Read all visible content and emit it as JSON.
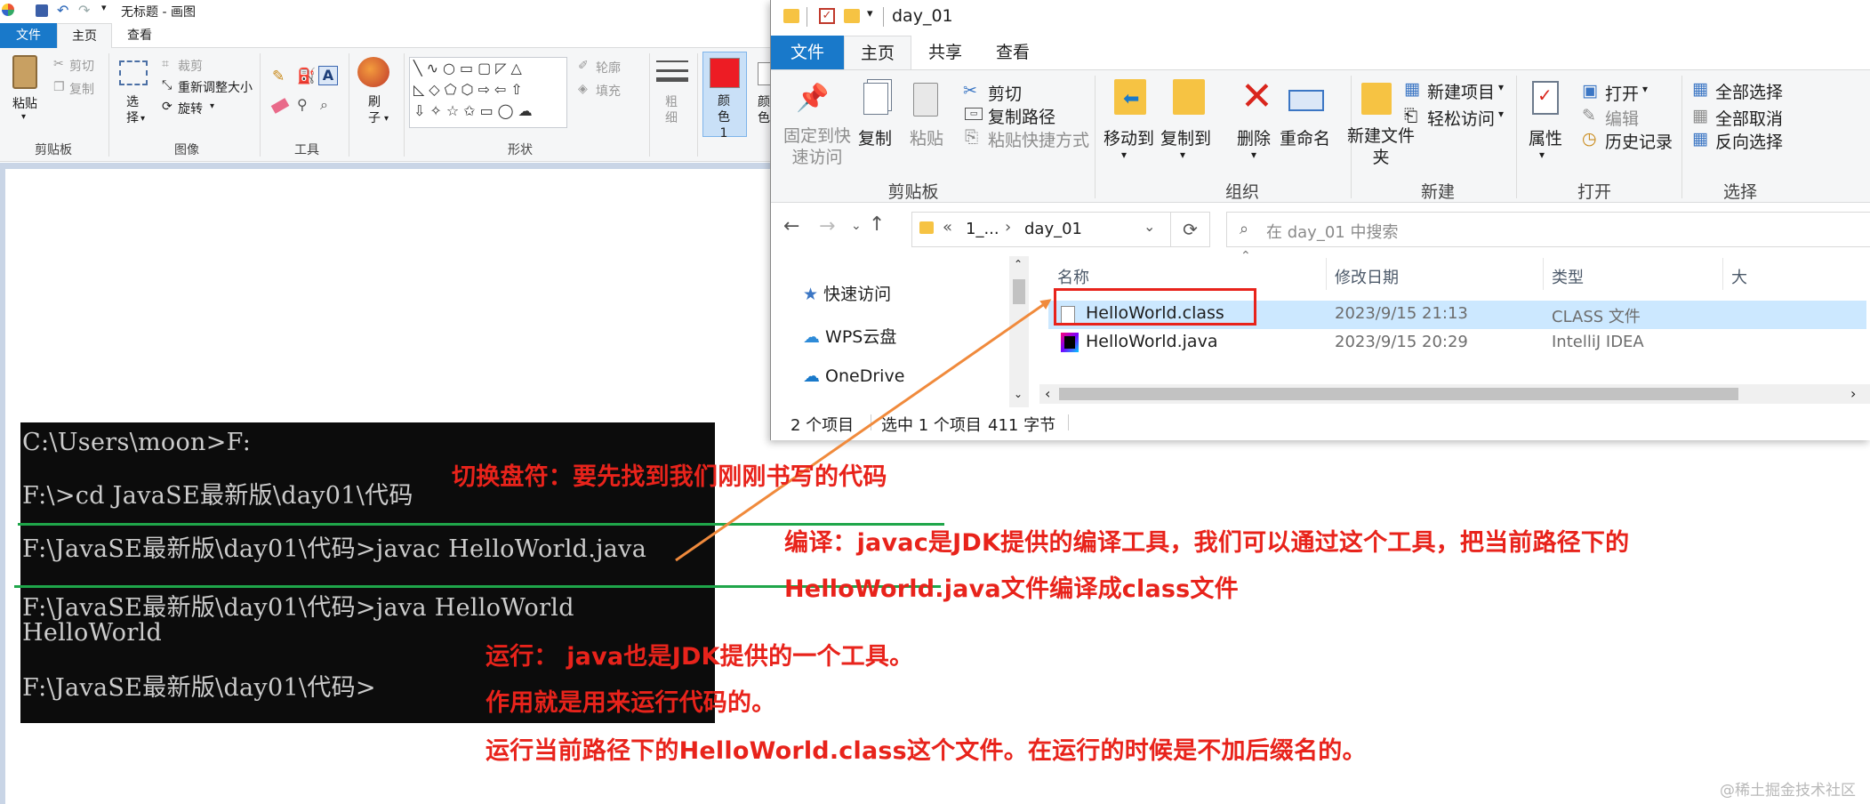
{
  "paint": {
    "title": "无标题 - 画图",
    "tabs": [
      {
        "label": "文件",
        "active": false,
        "accent": "#1979ca"
      },
      {
        "label": "主页",
        "active": true
      },
      {
        "label": "查看",
        "active": false
      }
    ],
    "clipboard": {
      "paste": "粘贴",
      "cut": "剪切",
      "copy": "复制",
      "label": "剪贴板"
    },
    "image": {
      "select": "选择",
      "crop": "裁剪",
      "resize": "重新调整大小",
      "rotate": "旋转",
      "label": "图像"
    },
    "tools": {
      "label": "工具"
    },
    "brush": {
      "label": "刷子"
    },
    "shapes": {
      "outline": "轮廓",
      "fill": "填充",
      "label": "形状"
    },
    "size": {
      "label": "粗细"
    },
    "color1": {
      "label": "颜色 1",
      "color": "#ed1c24"
    },
    "color2": {
      "label": "颜色"
    }
  },
  "cmd": {
    "lines": [
      "C:\\Users\\moon>F:",
      "F:\\>cd JavaSE最新版\\day01\\代码",
      "F:\\JavaSE最新版\\day01\\代码>javac HelloWorld.java",
      "F:\\JavaSE最新版\\day01\\代码>java HelloWorld",
      "HelloWorld",
      "F:\\JavaSE最新版\\day01\\代码>"
    ]
  },
  "explorer": {
    "title": "day_01",
    "tabs": [
      {
        "label": "文件",
        "accent": "#1979ca"
      },
      {
        "label": "主页"
      },
      {
        "label": "共享"
      },
      {
        "label": "查看"
      }
    ],
    "clipboard": {
      "pin": "固定到快速访问",
      "copy": "复制",
      "paste": "粘贴",
      "cut": "剪切",
      "copy_path": "复制路径",
      "paste_shortcut": "粘贴快捷方式",
      "label": "剪贴板"
    },
    "organize": {
      "move_to": "移动到",
      "copy_to": "复制到",
      "delete": "删除",
      "rename": "重命名",
      "label": "组织"
    },
    "new": {
      "new_folder": "新建文件夹",
      "new_item": "新建项目",
      "easy_access": "轻松访问",
      "label": "新建"
    },
    "open": {
      "properties": "属性",
      "open": "打开",
      "edit": "编辑",
      "history": "历史记录",
      "label": "打开"
    },
    "select": {
      "select_all": "全部选择",
      "select_none": "全部取消",
      "invert": "反向选择",
      "label": "选择"
    },
    "address": {
      "crumb1": "1_...",
      "crumb2": "day_01",
      "search_placeholder": "在 day_01 中搜索"
    },
    "nav": [
      {
        "label": "快速访问",
        "icon": "star-icon"
      },
      {
        "label": "WPS云盘",
        "icon": "cloud-icon"
      },
      {
        "label": "OneDrive",
        "icon": "onedrive-icon"
      }
    ],
    "columns": {
      "name": "名称",
      "date": "修改日期",
      "type": "类型",
      "size": "大"
    },
    "files": [
      {
        "name": "HelloWorld.class",
        "date": "2023/9/15 21:13",
        "type": "CLASS 文件",
        "selected": true
      },
      {
        "name": "HelloWorld.java",
        "date": "2023/9/15 20:29",
        "type": "IntelliJ IDEA",
        "selected": false
      }
    ],
    "status": {
      "count": "2 个项目",
      "selected": "选中 1 个项目",
      "size": "411 字节"
    }
  },
  "annotations": {
    "switch_drive": "切换盘符：要先找到我们刚刚书写的代码",
    "compile_1": "编译：javac是JDK提供的编译工具，我们可以通过这个工具，把当前路径下的",
    "compile_2": "HelloWorld.java文件编译成class文件",
    "run_1": "运行： java也是JDK提供的一个工具。",
    "run_2": "作用就是用来运行代码的。",
    "run_3": "运行当前路径下的HelloWorld.class这个文件。在运行的时候是不加后缀名的。",
    "color": "#e8231b",
    "line_color": "#1fa64a",
    "arrow_color": "#f08a3c"
  },
  "watermark": "@稀土掘金技术社区"
}
